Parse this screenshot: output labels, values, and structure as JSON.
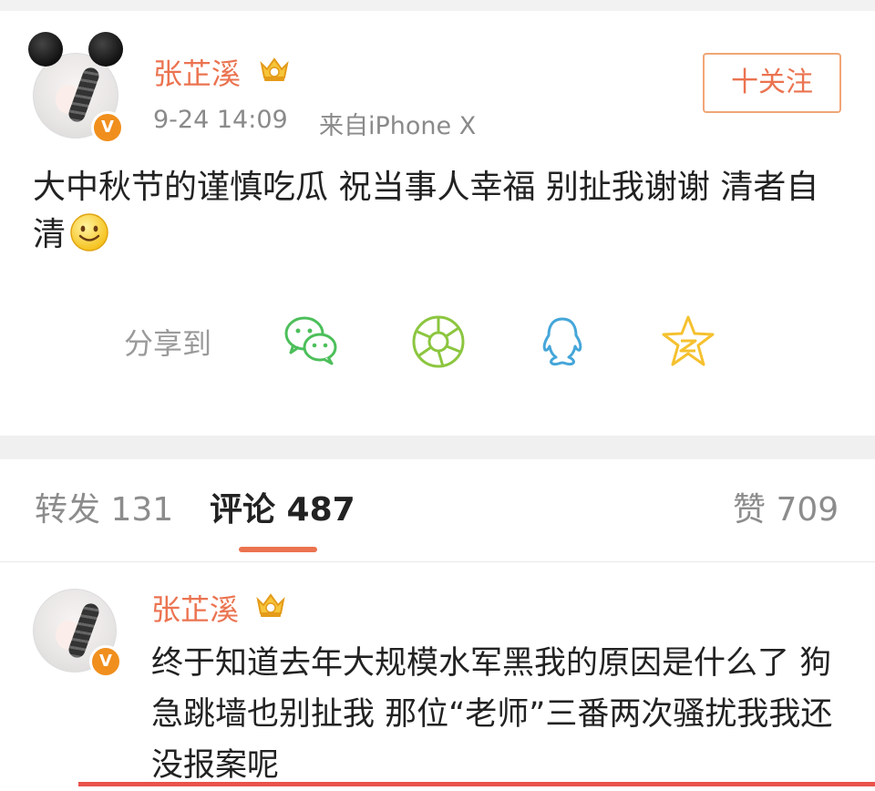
{
  "post": {
    "author": "张芷溪",
    "time": "9-24 14:09",
    "source": "来自iPhone X",
    "follow_label": "十关注",
    "content": "大中秋节的谨慎吃瓜 祝当事人幸福 别扯我谢谢 清者自清",
    "share_label": "分享到",
    "share_icons": [
      "wechat-icon",
      "moments-icon",
      "qq-icon",
      "qzone-icon"
    ]
  },
  "tabs": [
    {
      "label": "转发 131",
      "active": false
    },
    {
      "label": "评论 487",
      "active": true
    },
    {
      "label": "赞 709",
      "active": false
    }
  ],
  "comment": {
    "author": "张芷溪",
    "text": "终于知道去年大规模水军黑我的原因是什么了 狗急跳墙也别扯我 那位“老师”三番两次骚扰我我还没报案呢"
  },
  "colors": {
    "accent": "#eb7350",
    "badge": "#f08f1d",
    "muted": "#8a8a8a"
  }
}
